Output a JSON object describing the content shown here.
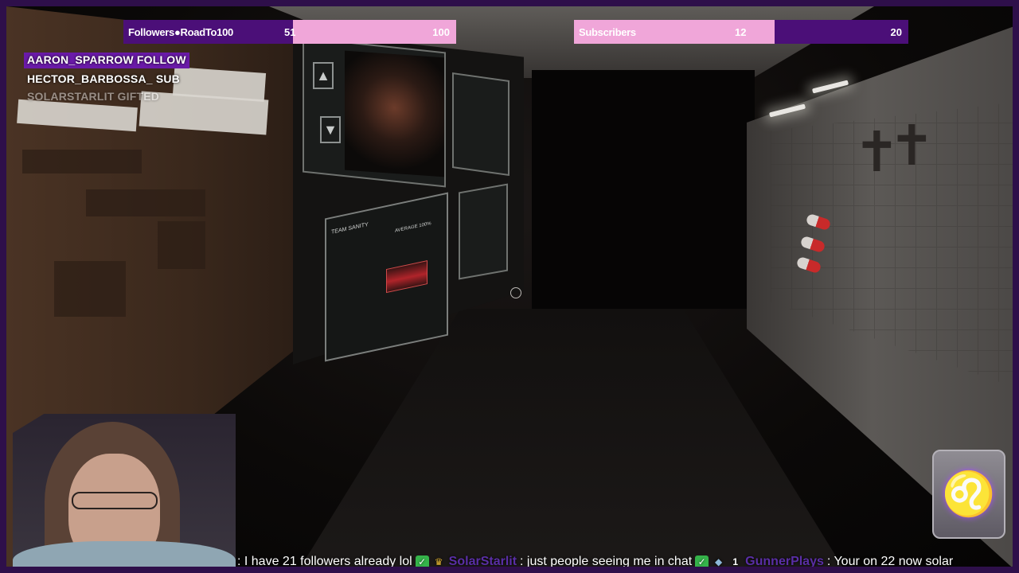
{
  "goals": {
    "followers": {
      "label": "Followers●RoadTo100",
      "current": "51",
      "target": "100",
      "progress": 0.51
    },
    "subscribers": {
      "label": "Subscribers",
      "current": "12",
      "target": "20",
      "progress": 0.6
    }
  },
  "alerts": [
    {
      "text": "AARON_SPARROW  FOLLOW"
    },
    {
      "text": "HECTOR_BARBOSSA_  SUB"
    },
    {
      "text": "SOLARSTARLIT  GIFTED"
    }
  ],
  "game": {
    "sanity_title": "TEAM SANITY",
    "sanity_average": "AVERAGE 100%"
  },
  "chat": {
    "messages": [
      {
        "user": "",
        "text": ": I have 21 followers already lol"
      },
      {
        "user": "SolarStarlit",
        "text": ": just people seeing me in chat"
      },
      {
        "user": "GunnerPlays",
        "text": ": Your on 22 now solar"
      }
    ]
  },
  "colors": {
    "frame": "#2e0f4a",
    "goal_bg": "#4b0f78",
    "goal_fill": "#f0a6d9",
    "alert_highlight": "#6a1aa8"
  },
  "icons": [
    "check-badge-icon",
    "crown-badge-icon",
    "diamond-badge-icon",
    "crosshair-icon",
    "up-arrow-icon",
    "down-arrow-icon",
    "lion-emblem-icon"
  ]
}
